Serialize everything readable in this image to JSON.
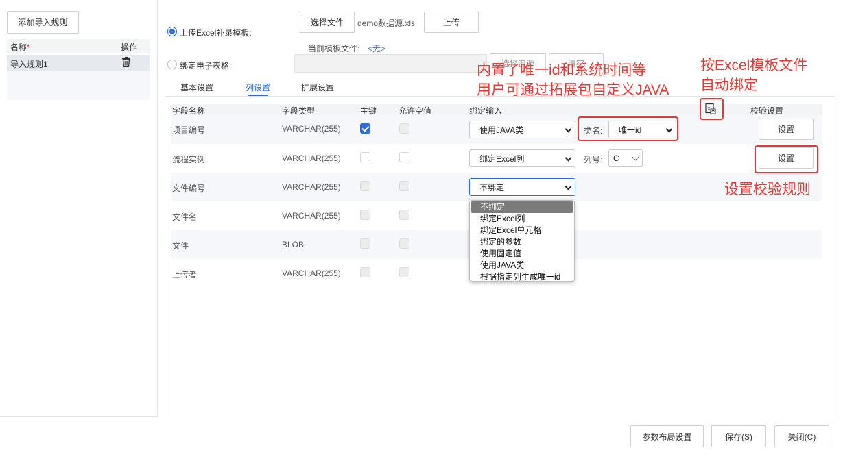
{
  "left_panel": {
    "add_rule_label": "添加导入规则",
    "col_name": "名称",
    "required_mark": "*",
    "col_action": "操作",
    "rules": [
      {
        "name": "导入规则1"
      }
    ]
  },
  "source": {
    "upload_excel_label": "上传Excel补录模板:",
    "choose_file_label": "选择文件",
    "file_name": "demo数据源.xls",
    "upload_label": "上传",
    "current_template_label": "当前模板文件:",
    "current_template_value": "<无>",
    "bind_sheet_label": "绑定电子表格:",
    "select_source_label": "选择资源",
    "clear_label": "清空"
  },
  "tabs": [
    {
      "label": "基本设置"
    },
    {
      "label": "列设置",
      "active": true
    },
    {
      "label": "扩展设置"
    }
  ],
  "grid": {
    "headers": {
      "field_name": "字段名称",
      "field_type": "字段类型",
      "primary_key": "主键",
      "allow_null": "允许空值",
      "binding": "绑定输入",
      "validation": "校验设置"
    },
    "rows": [
      {
        "name": "项目编号",
        "type": "VARCHAR(255)",
        "binding": "使用JAVA类",
        "extra_label": "类名:",
        "extra_value": "唯一id",
        "validate_label": "设置"
      },
      {
        "name": "流程实例",
        "type": "VARCHAR(255)",
        "binding": "绑定Excel列",
        "extra_label": "列号:",
        "extra_value": "C",
        "validate_label": "设置"
      },
      {
        "name": "文件编号",
        "type": "VARCHAR(255)",
        "binding": "不绑定"
      },
      {
        "name": "文件名",
        "type": "VARCHAR(255)"
      },
      {
        "name": "文件",
        "type": "BLOB"
      },
      {
        "name": "上传者",
        "type": "VARCHAR(255)"
      }
    ],
    "dropdown_options": [
      "不绑定",
      "绑定Excel列",
      "绑定Excel单元格",
      "绑定的参数",
      "使用固定值",
      "使用JAVA类",
      "根据指定列生成唯一id"
    ]
  },
  "annotations": {
    "java_line1": "内置了唯一id和系统时间等",
    "java_line2": "用户可通过拓展包自定义JAVA",
    "excel_line1": "按Excel模板文件",
    "excel_line2": "自动绑定",
    "validate": "设置校验规则"
  },
  "footer": {
    "layout_label": "参数布局设置",
    "save_label": "保存(S)",
    "close_label": "关闭(C)"
  },
  "colors": {
    "accent": "#2b6ed9",
    "annotation": "#e53935"
  }
}
